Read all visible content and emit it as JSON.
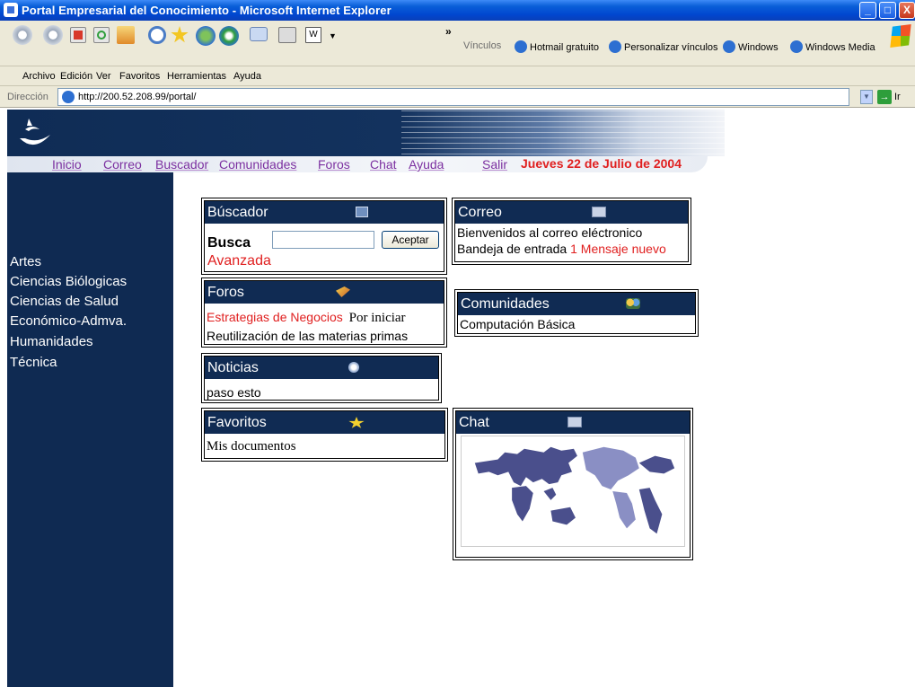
{
  "window": {
    "title": "Portal Empresarial del Conocimiento - Microsoft Internet Explorer",
    "min_symbol": "_",
    "max_symbol": "□",
    "close_symbol": "X"
  },
  "toolbar": {
    "chevron": "»",
    "links_label": "Vínculos",
    "links": [
      "Hotmail gratuito",
      "Personalizar vínculos",
      "Windows",
      "Windows Media"
    ]
  },
  "menubar": {
    "items": [
      "Archivo",
      "Edición",
      "Ver",
      "Favoritos",
      "Herramientas",
      "Ayuda"
    ]
  },
  "address": {
    "label": "Dirección",
    "url": "http://200.52.208.99/portal/",
    "go_label": "Ir",
    "go_symbol": "→",
    "drop_symbol": "▼"
  },
  "nav": {
    "links": [
      "Inicio",
      "Correo",
      "Buscador",
      "Comunidades",
      "Foros",
      "Chat",
      "Ayuda",
      "Salir"
    ],
    "date": "Jueves 22 de Julio de 2004"
  },
  "sidebar": {
    "items": [
      "Artes",
      "Ciencias Biólogicas",
      "Ciencias de Salud",
      "Económico-Admva.",
      "Humanidades",
      "Técnica"
    ]
  },
  "buscador": {
    "title": "Búscador",
    "label": "Busca",
    "input_value": "",
    "button": "Aceptar",
    "advanced": "Avanzada"
  },
  "correo": {
    "title": "Correo",
    "welcome": "Bienvenidos al correo eléctronico",
    "inbox_label": "Bandeja de entrada",
    "new_messages": "1 Mensaje nuevo"
  },
  "foros": {
    "title": "Foros",
    "topic1": "Estrategias de Negocios",
    "topic1_status": "Por iniciar",
    "topic2": "Reutilización de las materias primas"
  },
  "comunidades": {
    "title": "Comunidades",
    "item": "Computación Básica"
  },
  "noticias": {
    "title": "Noticias",
    "item": "paso esto"
  },
  "favoritos": {
    "title": "Favoritos",
    "item": "Mis documentos"
  },
  "chat": {
    "title": "Chat"
  },
  "colors": {
    "header_navy": "#102b53",
    "accent_red": "#e01f1f",
    "nav_purple": "#7b2fa0"
  }
}
